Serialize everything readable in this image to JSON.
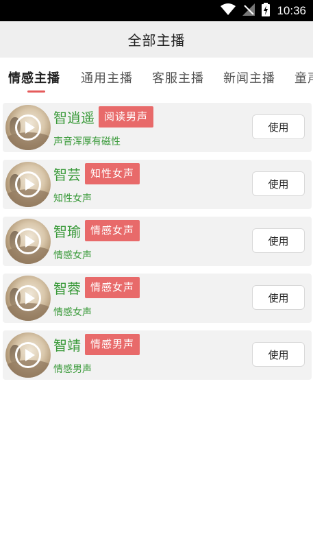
{
  "status_bar": {
    "time": "10:36"
  },
  "header": {
    "title": "全部主播"
  },
  "tabs": [
    {
      "label": "情感主播",
      "active": true
    },
    {
      "label": "通用主播",
      "active": false
    },
    {
      "label": "客服主播",
      "active": false
    },
    {
      "label": "新闻主播",
      "active": false
    },
    {
      "label": "童声主播",
      "active": false
    }
  ],
  "anchors": [
    {
      "name": "智逍遥",
      "tag": "阅读男声",
      "desc": "声音浑厚有磁性",
      "button": "使用"
    },
    {
      "name": "智芸",
      "tag": "知性女声",
      "desc": "知性女声",
      "button": "使用"
    },
    {
      "name": "智瑜",
      "tag": "情感女声",
      "desc": "情感女声",
      "button": "使用"
    },
    {
      "name": "智蓉",
      "tag": "情感女声",
      "desc": "情感女声",
      "button": "使用"
    },
    {
      "name": "智靖",
      "tag": "情感男声",
      "desc": "情感男声",
      "button": "使用"
    }
  ],
  "colors": {
    "accent": "#e55b5b",
    "tag_bg": "#e86a6a",
    "green_text": "#3a9a3a",
    "header_bg": "#efefef",
    "card_bg": "#f2f2f2"
  },
  "icons": [
    "wifi-icon",
    "no-signal-icon",
    "battery-charging-icon",
    "play-icon"
  ]
}
